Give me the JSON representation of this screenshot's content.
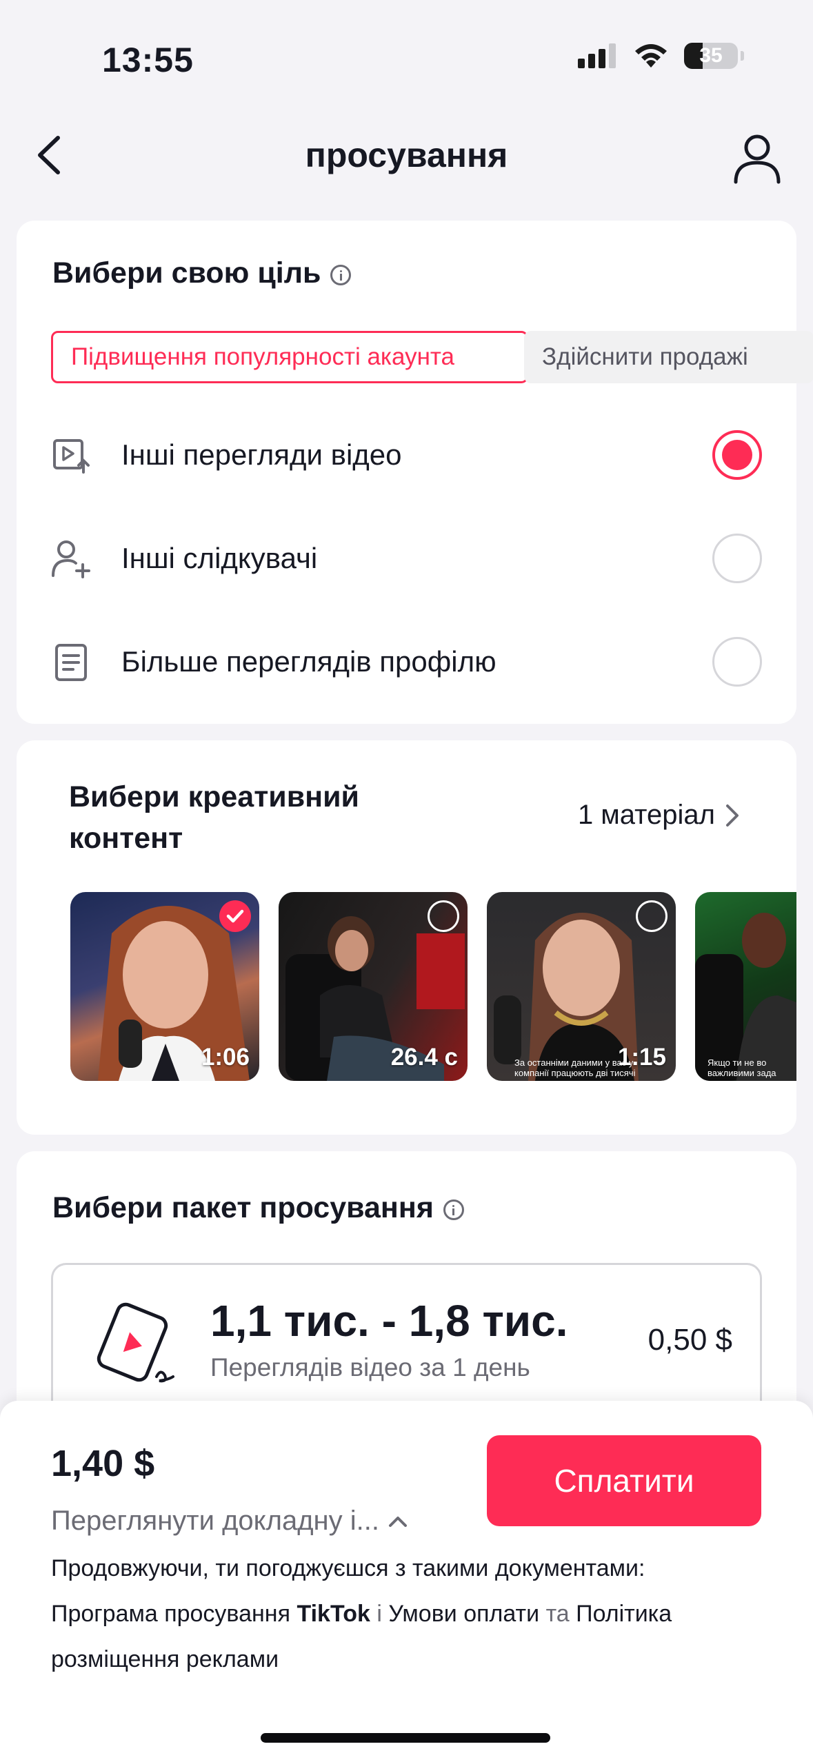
{
  "status_bar": {
    "time": "13:55",
    "battery": "35"
  },
  "header": {
    "title": "просування"
  },
  "goal": {
    "title": "Вибери свою ціль",
    "tabs": [
      {
        "label": "Підвищення популярності акаунта",
        "active": true
      },
      {
        "label": "Здійснити продажі",
        "active": false
      }
    ],
    "options": [
      {
        "label": "Інші перегляди відео",
        "icon": "video-views-icon",
        "selected": true
      },
      {
        "label": "Інші слідкувачі",
        "icon": "add-follower-icon",
        "selected": false
      },
      {
        "label": "Більше переглядів профілю",
        "icon": "profile-doc-icon",
        "selected": false
      }
    ]
  },
  "creative": {
    "title_line1": "Вибери креативний",
    "title_line2": "контент",
    "count_label": "1 матеріал",
    "videos": [
      {
        "duration": "1:06",
        "selected": true
      },
      {
        "duration": "26.4 с",
        "selected": false
      },
      {
        "duration": "1:15",
        "selected": false,
        "caption": "За останніми даними у вас у компанії працюють дві тисячі"
      },
      {
        "duration": "",
        "selected": false,
        "caption": "Якщо ти не во важливими зада"
      }
    ]
  },
  "package": {
    "title": "Вибери пакет просування",
    "range": "1,1 тис. - 1,8 тис.",
    "subtitle": "Переглядів відео за 1 день",
    "price": "0,50 $"
  },
  "footer": {
    "total": "1,40 $",
    "details_link": "Переглянути докладну і...",
    "pay_label": "Сплатити",
    "legal": {
      "intro": "Продовжуючи, ти погоджуєшся з такими документами:",
      "program_link": "Програма просування",
      "brand": "TikTok",
      "and": "і",
      "terms_link": "Умови оплати",
      "conj": "та",
      "policy_link": "Політика розміщення реклами"
    }
  },
  "colors": {
    "accent": "#fe2c55",
    "text": "#161823",
    "muted": "#6b6b74",
    "background": "#f4f3f7"
  }
}
